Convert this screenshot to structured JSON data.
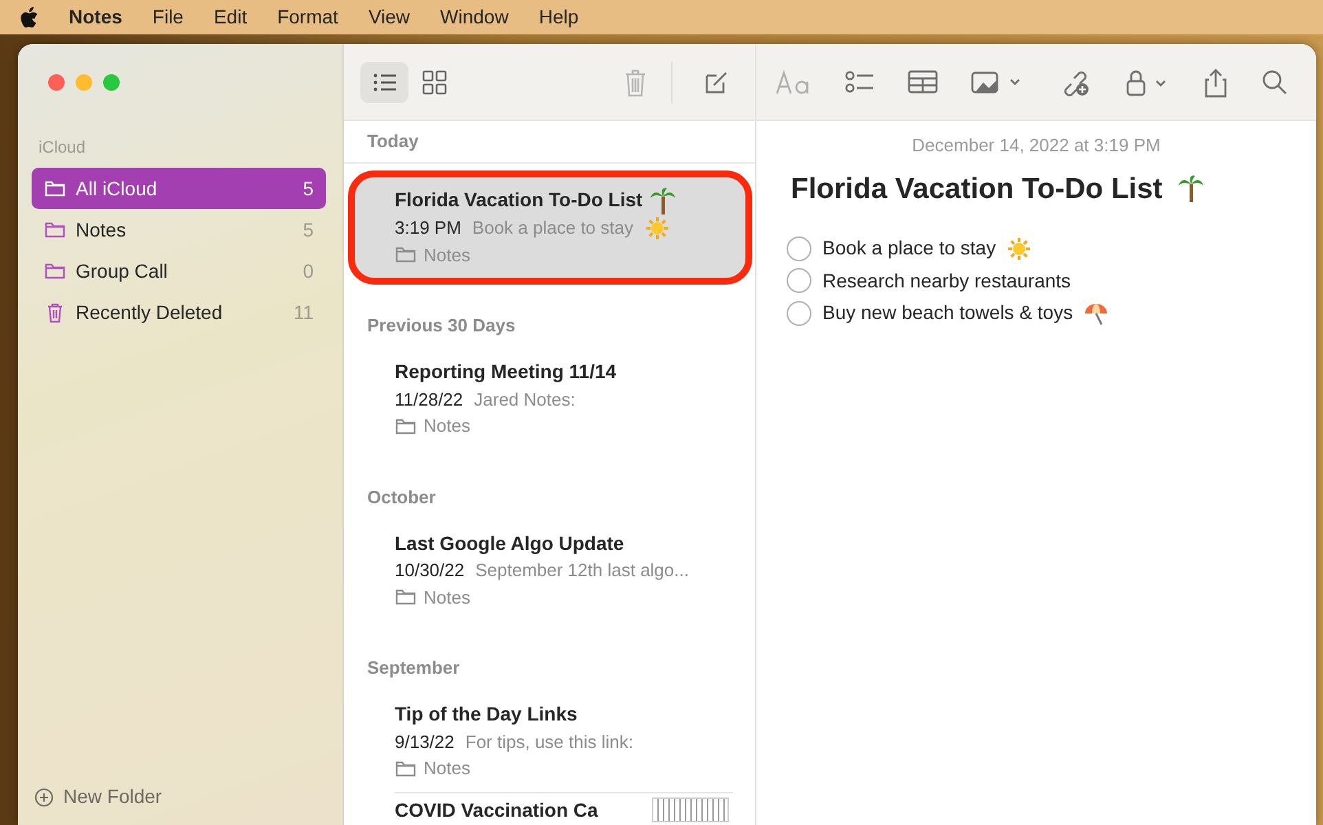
{
  "menu_bar": {
    "app": "Notes",
    "items": [
      "File",
      "Edit",
      "Format",
      "View",
      "Window",
      "Help"
    ]
  },
  "toolbar": {
    "view_modes": [
      {
        "kind": "list",
        "selected": true
      },
      {
        "kind": "gallery",
        "selected": false
      }
    ]
  },
  "sidebar": {
    "account": "iCloud",
    "items": [
      {
        "kind": "folder",
        "label": "All iCloud",
        "count": "5",
        "selected": true
      },
      {
        "kind": "folder",
        "label": "Notes",
        "count": "5",
        "selected": false
      },
      {
        "kind": "folder",
        "label": "Group Call",
        "count": "0",
        "selected": false
      },
      {
        "kind": "trash",
        "label": "Recently Deleted",
        "count": "11",
        "selected": false
      }
    ],
    "new_folder": "New Folder"
  },
  "note_list": {
    "sections": [
      {
        "title": "Today",
        "notes": [
          {
            "title": "Florida Vacation To-Do List",
            "palm_icon": true,
            "date": "3:19 PM",
            "snippet": "Book a place to stay",
            "sun_icon": true,
            "folder": "Notes",
            "selected": true,
            "highlighted": true
          }
        ]
      },
      {
        "title": "Previous 30 Days",
        "notes": [
          {
            "title": "Reporting Meeting 11/14",
            "date": "11/28/22",
            "snippet": "Jared Notes:",
            "folder": "Notes",
            "selected": false,
            "highlighted": false
          }
        ]
      },
      {
        "title": "October",
        "notes": [
          {
            "title": "Last Google Algo Update",
            "date": "10/30/22",
            "snippet": "September 12th last algo...",
            "folder": "Notes",
            "selected": false,
            "highlighted": false
          }
        ]
      },
      {
        "title": "September",
        "notes": [
          {
            "title": "Tip of the Day Links",
            "date": "9/13/22",
            "snippet": "For tips, use this link:",
            "folder": "Notes",
            "selected": false,
            "highlighted": false
          },
          {
            "title": "COVID Vaccination Ca",
            "thumbnail": true,
            "selected": false,
            "highlighted": false
          }
        ]
      }
    ]
  },
  "editor": {
    "timestamp": "December 14, 2022 at 3:19 PM",
    "title": "Florida Vacation To-Do List",
    "palm_icon": true,
    "checklist": [
      {
        "text": "Book a place to stay",
        "sun_icon": true,
        "checked": false
      },
      {
        "text": "Research nearby restaurants",
        "checked": false
      },
      {
        "text": "Buy new beach towels & toys",
        "umbrella_icon": true,
        "checked": false
      }
    ]
  }
}
